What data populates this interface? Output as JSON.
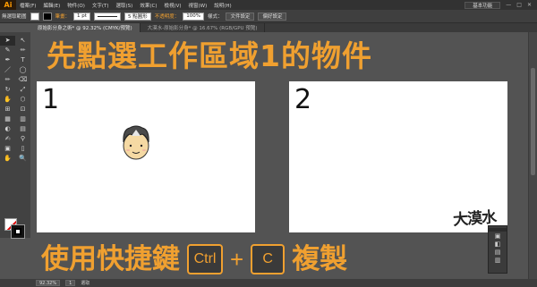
{
  "app": {
    "logo": "Ai"
  },
  "menu": [
    "檔案(F)",
    "編輯(E)",
    "物件(O)",
    "文字(T)",
    "選取(S)",
    "效果(C)",
    "檢視(V)",
    "視窗(W)",
    "說明(H)"
  ],
  "workspace": "基本功能",
  "window_controls": [
    "—",
    "□",
    "✕"
  ],
  "control": {
    "selection_label": "無選取範圍",
    "stroke_label": "筆畫：",
    "stroke_weight": "1 pt",
    "brush_label": "5 點圓形",
    "opacity_label": "不透明度：",
    "opacity_value": "100%",
    "style_label": "樣式：",
    "doc_setup": "文件設定",
    "preferences": "偏好設定"
  },
  "tabs": [
    {
      "label": "原始影分身之術* @ 92.32% (CMYK/預覽)",
      "active": true
    },
    {
      "label": "大漠水-原始影分身* @ 16.67% (RGB/GPU 預覽)",
      "active": false
    }
  ],
  "tools": [
    "➤",
    "↖",
    "✎",
    "✏",
    "✒",
    "T",
    "／",
    "◯",
    "✏",
    "⌫",
    "↻",
    "⤢",
    "✋",
    "⬡",
    "⊞",
    "⊡",
    "▦",
    "▥",
    "◐",
    "▤",
    "✍",
    "⚲",
    "▣",
    "▯",
    "✋",
    "🔍"
  ],
  "headline": "先點選工作區域1的物件",
  "artboards": [
    {
      "number": "1"
    },
    {
      "number": "2"
    }
  ],
  "bottom": {
    "prefix": "使用快捷鍵",
    "key1": "Ctrl",
    "plus": "+",
    "key2": "C",
    "suffix": "複製"
  },
  "watermark": "大漠水",
  "panel_icons": [
    "▣",
    "◧",
    "▤",
    "▥"
  ],
  "status": {
    "zoom": "92.32%",
    "page": "1",
    "mode": "選取"
  },
  "colors": {
    "accent": "#f0a030",
    "app_bg": "#535353"
  }
}
